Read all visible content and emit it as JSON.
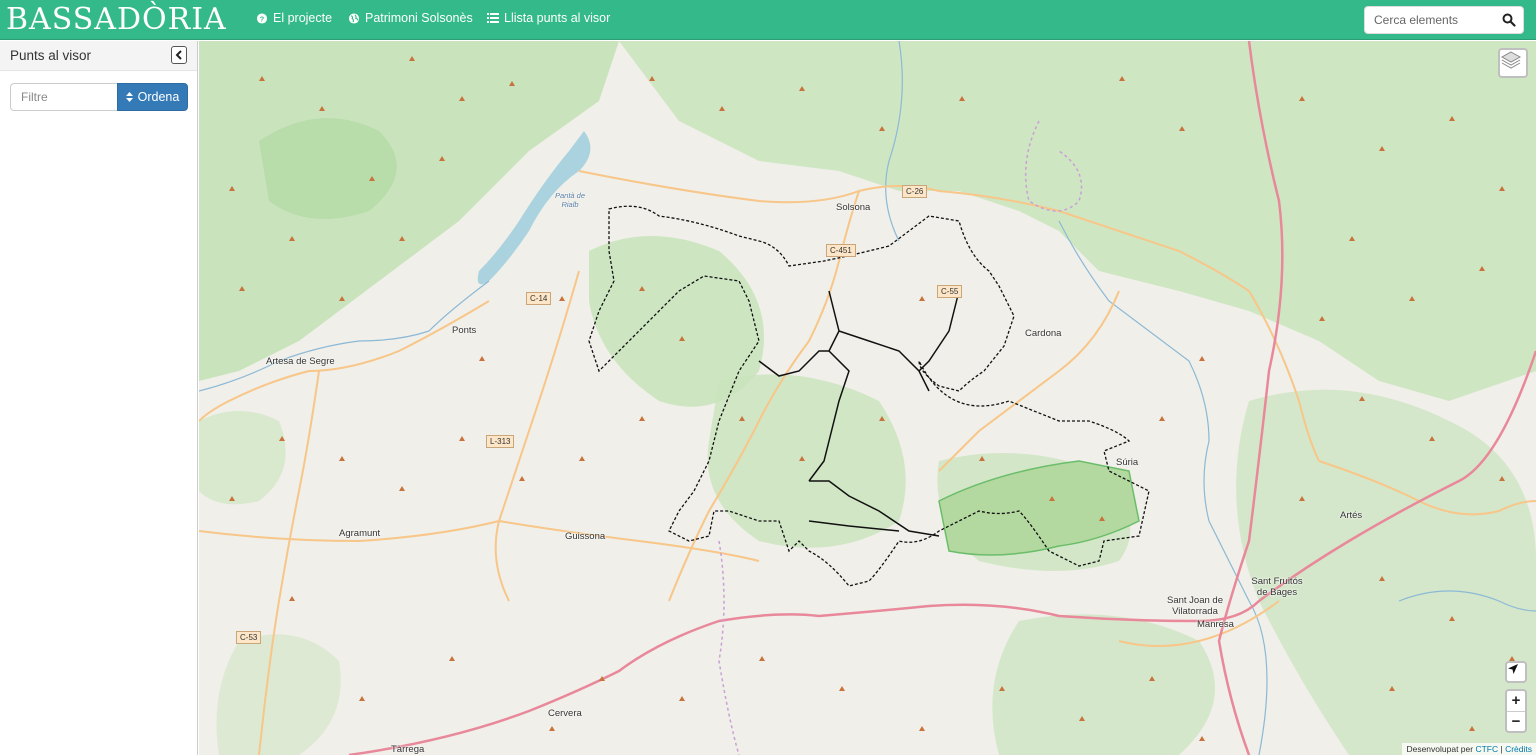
{
  "navbar": {
    "brand": "BASSADÒRIA",
    "items": [
      {
        "label": "El projecte",
        "icon": "question-circle-icon"
      },
      {
        "label": "Patrimoni Solsonès",
        "icon": "globe-icon"
      },
      {
        "label": "Llista punts al visor",
        "icon": "list-icon"
      }
    ],
    "search": {
      "placeholder": "Cerca elements",
      "icon": "search-icon"
    }
  },
  "sidebar": {
    "title": "Punts al visor",
    "filter_placeholder": "Filtre",
    "sort_label": "Ordena"
  },
  "map": {
    "places": [
      {
        "name": "Solsona"
      },
      {
        "name": "Cardona"
      },
      {
        "name": "Ponts"
      },
      {
        "name": "Artesa de Segre"
      },
      {
        "name": "Súria"
      },
      {
        "name": "Agramunt"
      },
      {
        "name": "Guissona"
      },
      {
        "name": "Artés"
      },
      {
        "name": "Sant Fruitós de Bages"
      },
      {
        "name": "Sant Joan de Vilatorrada"
      },
      {
        "name": "Manresa"
      },
      {
        "name": "Cervera"
      },
      {
        "name": "Tàrrega"
      },
      {
        "name": "Pantà de Rialb"
      }
    ],
    "roads": [
      "C-26",
      "C-451",
      "C-55",
      "C-14",
      "L-313",
      "C-53"
    ],
    "colors": {
      "land": "#f0efe9",
      "forest": "#c9e4bc",
      "water": "#aad3df",
      "motorway": "#e8889a",
      "primary": "#f7c688",
      "boundary": "#000000",
      "peak": "#c8733c"
    }
  },
  "controls": {
    "zoom_in": "+",
    "zoom_out": "−",
    "attribution_prefix": "Desenvolupat per ",
    "attribution_ctfc": "CTFC",
    "attribution_sep": " | ",
    "attribution_credits": "Crèdits"
  },
  "colors": {
    "navbar": "#34b98b",
    "sort_button": "#337ab7"
  }
}
